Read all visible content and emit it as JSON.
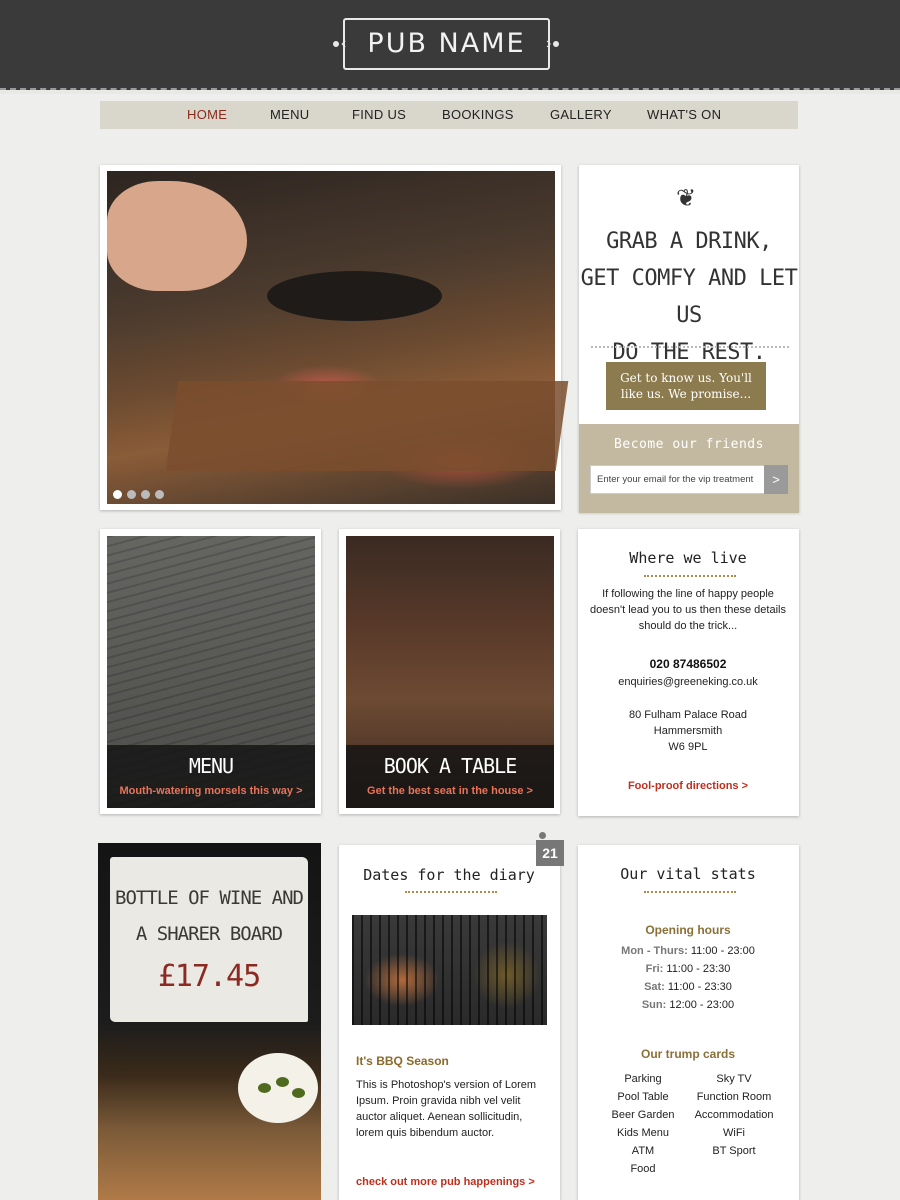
{
  "header": {
    "logo": "PUB NAME"
  },
  "nav": {
    "items": [
      "HOME",
      "MENU",
      "FIND US",
      "BOOKINGS",
      "GALLERY",
      "WHAT'S ON"
    ],
    "active": "HOME"
  },
  "hero": {
    "slide_count": 4,
    "current_slide": 1
  },
  "promo": {
    "icon": "hops-icon",
    "lines": [
      "GRAB A DRINK,",
      "GET COMFY AND LET US",
      "DO THE REST."
    ],
    "button": [
      "Get to know us. You'll",
      "like us. We promise..."
    ],
    "newsletter_title": "Become our friends",
    "newsletter_placeholder": "Enter your email for the vip treatment",
    "newsletter_submit": ">"
  },
  "tiles": [
    {
      "title": "MENU",
      "subtitle": "Mouth-watering morsels this way >"
    },
    {
      "title": "BOOK A TABLE",
      "subtitle": "Get the best seat in the house >"
    }
  ],
  "location": {
    "heading": "Where we live",
    "intro": [
      "If following the line of happy people",
      "doesn't lead you to us then these details",
      "should do the trick..."
    ],
    "phone": "020 87486502",
    "email": "enquiries@greeneking.co.uk",
    "address": [
      "80 Fulham Palace Road",
      "Hammersmith",
      "W6 9PL"
    ],
    "directions": "Fool-proof directions >"
  },
  "offer": {
    "lines": [
      "BOTTLE OF WINE AND",
      "A SHARER BOARD"
    ],
    "price": "£17.45"
  },
  "diary": {
    "heading": "Dates for the diary",
    "badge": "21",
    "item_title": "It's BBQ Season",
    "item_text": [
      "This is Photoshop's version  of Lorem",
      "Ipsum. Proin gravida nibh vel velit",
      "auctor aliquet. Aenean sollicitudin,",
      "lorem quis bibendum auctor."
    ],
    "link": "check out more pub happenings >"
  },
  "stats": {
    "heading": "Our vital stats",
    "hours_heading": "Opening hours",
    "hours": [
      {
        "day": "Mon - Thurs:",
        "time": "11:00 - 23:00"
      },
      {
        "day": "Fri:",
        "time": "11:00 - 23:30"
      },
      {
        "day": "Sat:",
        "time": "11:00 - 23:30"
      },
      {
        "day": "Sun:",
        "time": "12:00 - 23:00"
      }
    ],
    "trump_heading": "Our trump cards",
    "trump_left": [
      "Parking",
      "Pool Table",
      "Beer Garden",
      "Kids Menu",
      "ATM",
      "Food"
    ],
    "trump_right": [
      "Sky TV",
      "Function Room",
      "Accommodation",
      "WiFi",
      "BT Sport"
    ]
  },
  "colors": {
    "header_bg": "#3a3a3a",
    "nav_bg": "#d9d6cc",
    "accent_red": "#c0301f",
    "olive": "#8b7b4e",
    "active_nav": "#8b2a1a"
  }
}
